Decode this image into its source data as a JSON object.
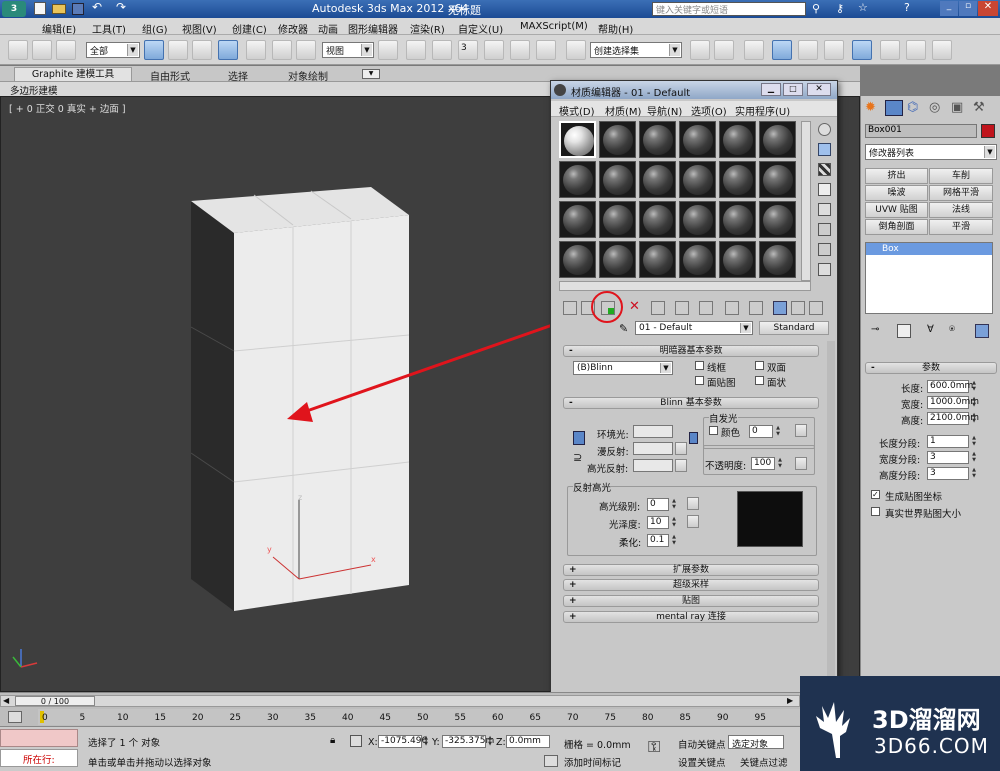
{
  "window": {
    "app_title": "Autodesk 3ds Max  2012 x64",
    "doc_title": "无标题",
    "search_placeholder": "键入关键字或短语"
  },
  "menu": [
    "编辑(E)",
    "工具(T)",
    "组(G)",
    "视图(V)",
    "创建(C)",
    "修改器",
    "动画",
    "图形编辑器",
    "渲染(R)",
    "自定义(U)",
    "MAXScript(M)",
    "帮助(H)"
  ],
  "toolbar": {
    "selection_filter": "全部",
    "ref_coord": "视图",
    "named_selection": "创建选择集",
    "snap_label": "3"
  },
  "ribbon": {
    "tabs": [
      "Graphite 建模工具",
      "自由形式",
      "选择",
      "对象绘制"
    ],
    "sub_label": "多边形建模"
  },
  "viewport": {
    "label": "[ + 0 正交 0 真实 + 边面 ]",
    "gizmo": {
      "x": "x",
      "y": "y",
      "z": "z"
    }
  },
  "material_editor": {
    "title": "材质编辑器 - 01 - Default",
    "menu": [
      "模式(D)",
      "材质(M)",
      "导航(N)",
      "选项(O)",
      "实用程序(U)"
    ],
    "material_name": "01 - Default",
    "material_type": "Standard",
    "shader_basic": {
      "header": "明暗器基本参数",
      "shader": "(B)Blinn",
      "wire": "线框",
      "two_sided": "双面",
      "face_map": "面贴图",
      "faceted": "面状"
    },
    "blinn_basic": {
      "header": "Blinn 基本参数",
      "self_illum": "自发光",
      "color_label": "颜色",
      "color_value": "0",
      "ambient": "环境光:",
      "diffuse": "漫反射:",
      "specular": "高光反射:",
      "opacity_label": "不透明度:",
      "opacity_value": "100"
    },
    "specular_highlights": {
      "header": "反射高光",
      "level_label": "高光级别:",
      "level_value": "0",
      "gloss_label": "光泽度:",
      "gloss_value": "10",
      "soften_label": "柔化:",
      "soften_value": "0.1"
    },
    "rollouts": [
      "扩展参数",
      "超级采样",
      "贴图",
      "mental ray 连接"
    ]
  },
  "command_panel": {
    "object_name": "Box001",
    "color": "#c0141c",
    "modifier_list": "修改器列表",
    "modifier_buttons": [
      "挤出",
      "车削",
      "噪波",
      "网格平滑",
      "UVW 贴图",
      "法线",
      "倒角剖面",
      "平滑"
    ],
    "stack_item": "Box",
    "params_header": "参数",
    "length_label": "长度:",
    "length_value": "600.0mm",
    "width_label": "宽度:",
    "width_value": "1000.0mm",
    "height_label": "高度:",
    "height_value": "2100.0mm",
    "length_segs_label": "长度分段:",
    "length_segs_value": "1",
    "width_segs_label": "宽度分段:",
    "width_segs_value": "3",
    "height_segs_label": "高度分段:",
    "height_segs_value": "3",
    "gen_mapping": "生成贴图坐标",
    "real_world": "真实世界贴图大小"
  },
  "timeline": {
    "frame": "0 / 100",
    "ticks": [
      "0",
      "5",
      "10",
      "15",
      "20",
      "25",
      "30",
      "35",
      "40",
      "45",
      "50",
      "55",
      "60",
      "65",
      "70",
      "75",
      "80",
      "85",
      "90",
      "95"
    ]
  },
  "status": {
    "script_label": "所在行:",
    "selection_msg": "选择了 1 个 对象",
    "prompt_msg": "单击或单击并拖动以选择对象",
    "x_label": "X:",
    "x_value": "-1075.496",
    "y_label": "Y:",
    "y_value": "-325.375m",
    "z_label": "Z:",
    "z_value": "0.0mm",
    "grid": "栅格 = 0.0mm",
    "add_time_tag": "添加时间标记",
    "auto_key": "自动关键点",
    "selected": "选定对象",
    "set_key": "设置关键点",
    "key_filters": "关键点过滤"
  },
  "watermark": {
    "brand": "3D溜溜网",
    "url": "3D66.COM"
  },
  "annotation_color": "#e0141c"
}
